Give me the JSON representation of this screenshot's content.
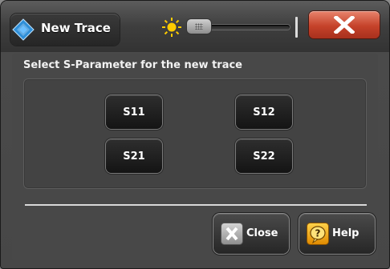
{
  "window": {
    "title": "New Trace",
    "icons": {
      "app": "rs-logo-icon",
      "brightness": "sun-icon",
      "close": "close-x-icon"
    },
    "colors": {
      "close_button": "#c5422a",
      "help_icon": "#f0a500",
      "sun": "#ffcc00"
    }
  },
  "dialog": {
    "heading": "Select S-Parameter for the new trace",
    "params": [
      "S11",
      "S12",
      "S21",
      "S22"
    ]
  },
  "footer": {
    "close_label": "Close",
    "help_label": "Help",
    "icons": {
      "close": "x-box-icon",
      "help": "question-bubble-icon"
    }
  }
}
